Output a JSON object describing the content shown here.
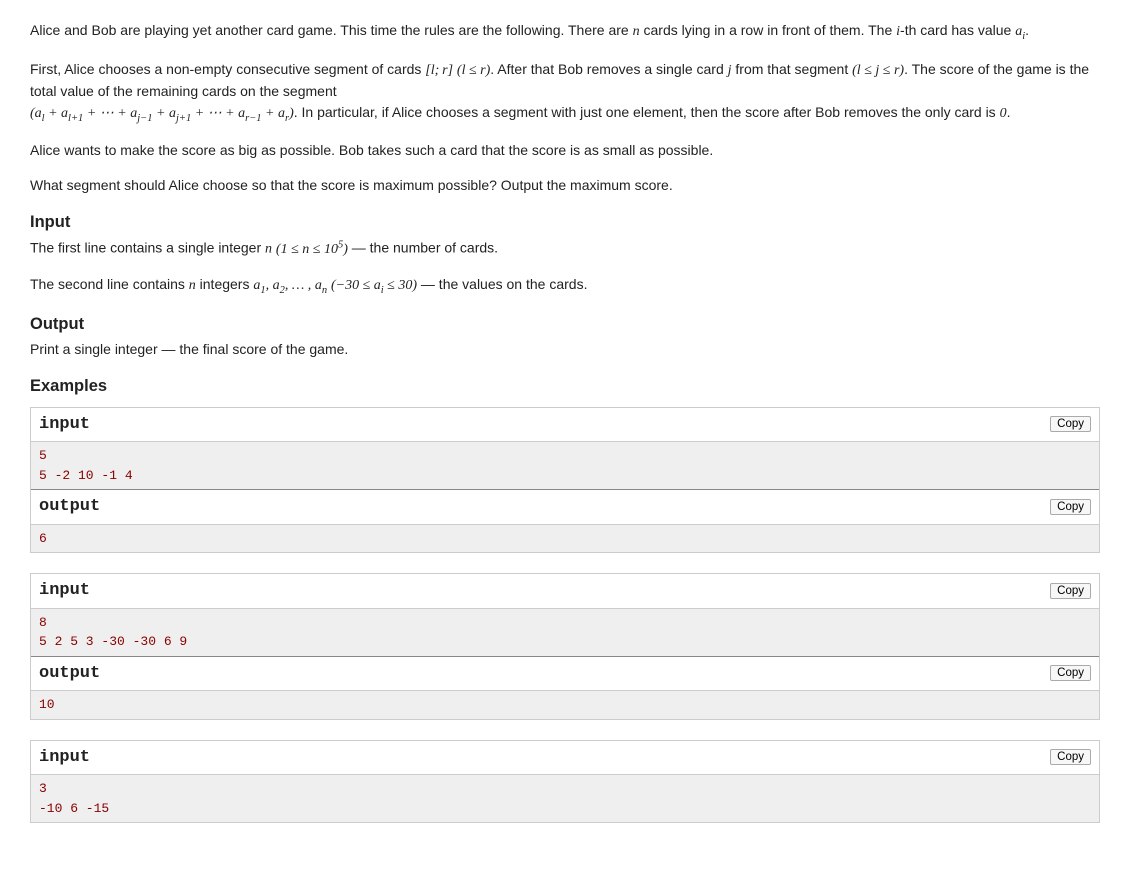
{
  "statement": {
    "p1_a": "Alice and Bob are playing yet another card game. This time the rules are the following. There are ",
    "p1_b": " cards lying in a row in front of them. The ",
    "p1_c": "-th card has value ",
    "p1_d": ".",
    "p2_a": "First, Alice chooses a non-empty consecutive segment of cards ",
    "p2_b": ". After that Bob removes a single card ",
    "p2_c": " from that segment ",
    "p2_d": ". The score of the game is the total value of the remaining cards on the segment ",
    "p2_e": ". In particular, if Alice chooses a segment with just one element, then the score after Bob removes the only card is ",
    "p2_f": ".",
    "p3": "Alice wants to make the score as big as possible. Bob takes such a card that the score is as small as possible.",
    "p4": "What segment should Alice choose so that the score is maximum possible? Output the maximum score."
  },
  "math": {
    "n": "n",
    "i": "i",
    "a_i": "a_i",
    "lr": "[l; r]",
    "l_le_r": "(l ≤ r)",
    "j": "j",
    "l_le_j_le_r": "(l ≤ j ≤ r)",
    "sum_expr": "(a_l + a_{l+1} + ⋯ + a_{j−1} + a_{j+1} + ⋯ + a_{r−1} + a_r)",
    "zero": "0",
    "n_range": "(1 ≤ n ≤ 10^5)",
    "a_list": "a_1, a_2, … , a_n",
    "a_range": "(−30 ≤ a_i ≤ 30)"
  },
  "input": {
    "title": "Input",
    "line1_a": "The first line contains a single integer ",
    "line1_b": " — the number of cards.",
    "line2_a": "The second line contains ",
    "line2_b": " integers ",
    "line2_c": " — the values on the cards."
  },
  "output": {
    "title": "Output",
    "text": "Print a single integer — the final score of the game."
  },
  "examples": {
    "title": "Examples",
    "input_label": "input",
    "output_label": "output",
    "copy_label": "Copy",
    "tests": [
      {
        "input": "5\n5 -2 10 -1 4",
        "output": "6"
      },
      {
        "input": "8\n5 2 5 3 -30 -30 6 9",
        "output": "10"
      },
      {
        "input": "3\n-10 6 -15"
      }
    ]
  }
}
